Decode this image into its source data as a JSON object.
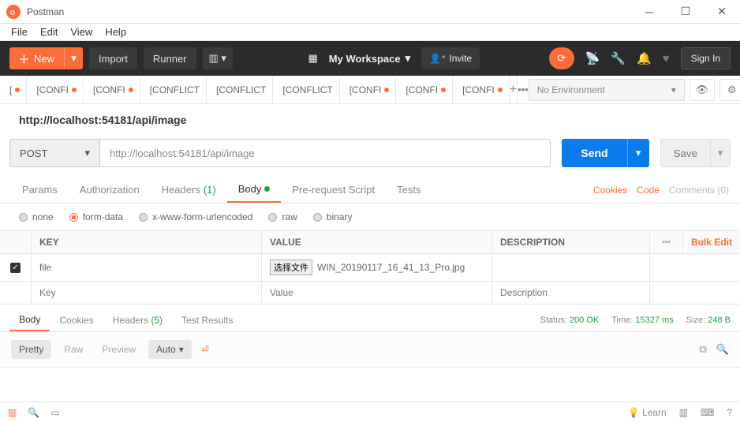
{
  "window": {
    "title": "Postman"
  },
  "menubar": {
    "file": "File",
    "edit": "Edit",
    "view": "View",
    "help": "Help"
  },
  "toolbar": {
    "new": "New",
    "import": "Import",
    "runner": "Runner",
    "workspace": "My Workspace",
    "invite": "Invite",
    "signin": "Sign In"
  },
  "tabs": {
    "items": [
      {
        "label": "[",
        "dirty": true
      },
      {
        "label": "[CONFI",
        "dirty": true
      },
      {
        "label": "[CONFI",
        "dirty": true
      },
      {
        "label": "[CONFLICT",
        "dirty": false
      },
      {
        "label": "[CONFLICT",
        "dirty": false
      },
      {
        "label": "[CONFLICT",
        "dirty": false
      },
      {
        "label": "[CONFI",
        "dirty": true
      },
      {
        "label": "[CONFI",
        "dirty": true
      },
      {
        "label": "[CONFI",
        "dirty": true
      }
    ],
    "env": "No Environment"
  },
  "request": {
    "title": "http://localhost:54181/api/image",
    "method": "POST",
    "url": "http://localhost:54181/api/image",
    "send": "Send",
    "save": "Save"
  },
  "subtabs": {
    "params": "Params",
    "auth": "Authorization",
    "headers": "Headers",
    "headers_count": "(1)",
    "body": "Body",
    "pre": "Pre-request Script",
    "tests": "Tests",
    "cookies": "Cookies",
    "code": "Code",
    "comments": "Comments (0)"
  },
  "bodytype": {
    "none": "none",
    "formdata": "form-data",
    "urlencoded": "x-www-form-urlencoded",
    "raw": "raw",
    "binary": "binary"
  },
  "kv": {
    "head_key": "KEY",
    "head_value": "VALUE",
    "head_desc": "DESCRIPTION",
    "bulk": "Bulk Edit",
    "row1_key": "file",
    "row1_filebtn": "选择文件",
    "row1_filename": "WIN_20190117_16_41_13_Pro.jpg",
    "row2_key_ph": "Key",
    "row2_value_ph": "Value",
    "row2_desc_ph": "Description"
  },
  "response": {
    "tabs": {
      "body": "Body",
      "cookies": "Cookies",
      "headers": "Headers",
      "headers_count": "(5)",
      "tests": "Test Results"
    },
    "status_label": "Status:",
    "status_value": "200 OK",
    "time_label": "Time:",
    "time_value": "15327 ms",
    "size_label": "Size:",
    "size_value": "248 B",
    "pretty": "Pretty",
    "raw": "Raw",
    "preview": "Preview",
    "auto": "Auto"
  },
  "statusbar": {
    "learn": "Learn"
  }
}
